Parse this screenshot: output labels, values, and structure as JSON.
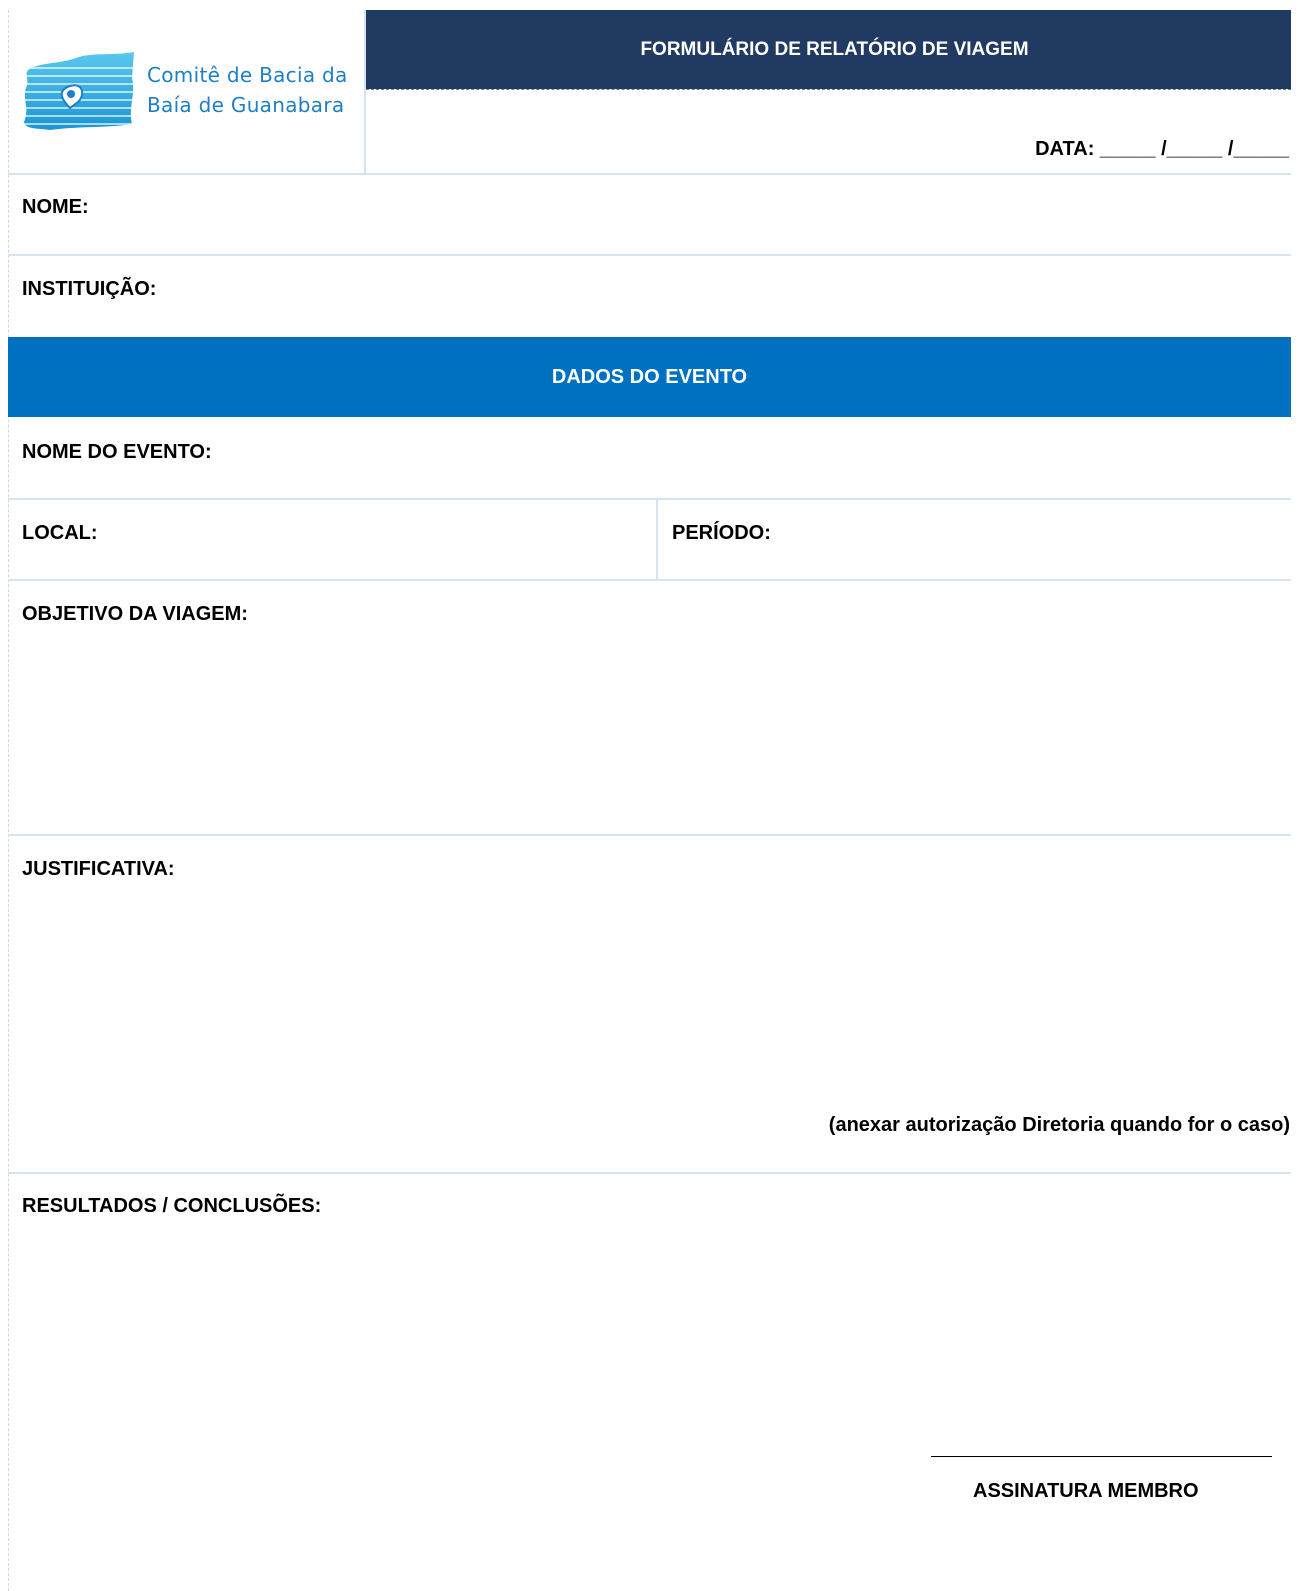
{
  "header": {
    "logo_line1": "Comitê de Bacia da",
    "logo_line2": "Baía de Guanabara",
    "title": "FORMULÁRIO DE RELATÓRIO DE VIAGEM",
    "data_label": "DATA:",
    "data_blank": "_____ /_____ /_____"
  },
  "fields": {
    "nome": "NOME:",
    "instituicao": "INSTITUIÇÃO:"
  },
  "section": {
    "title": "DADOS DO EVENTO"
  },
  "evento": {
    "nome_do_evento": "NOME DO EVENTO:",
    "local": "LOCAL:",
    "periodo": "PERÍODO:",
    "objetivo": "OBJETIVO DA VIAGEM:",
    "justificativa": "JUSTIFICATIVA:",
    "justificativa_note": "(anexar autorização Diretoria quando for o caso)",
    "resultados": "RESULTADOS / CONCLUSÕES:"
  },
  "signature": {
    "label": "ASSINATURA MEMBRO"
  },
  "colors": {
    "title_bar": "#213a62",
    "section_bar": "#0070c0",
    "logo_text": "#1f7fc4",
    "grid_line": "#d6e3f3"
  }
}
